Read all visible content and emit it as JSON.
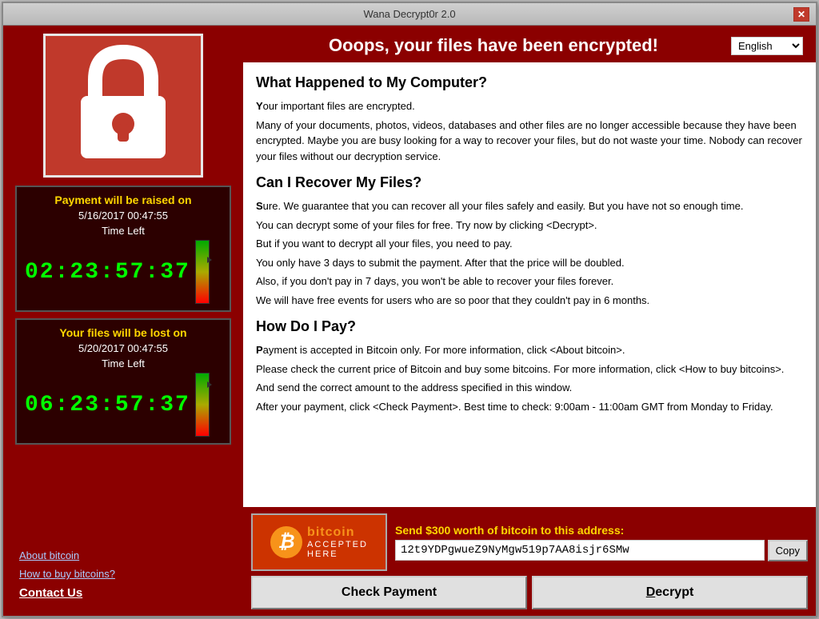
{
  "window": {
    "title": "Wana Decrypt0r 2.0",
    "close_btn": "✕"
  },
  "header": {
    "main_title": "Ooops, your files have been encrypted!",
    "language": "English"
  },
  "countdown1": {
    "label": "Payment will be raised on",
    "date": "5/16/2017 00:47:55",
    "time_left_label": "Time Left",
    "timer": "02:23:57:37"
  },
  "countdown2": {
    "label": "Your files will be lost on",
    "date": "5/20/2017 00:47:55",
    "time_left_label": "Time Left",
    "timer": "06:23:57:37"
  },
  "links": {
    "about_bitcoin": "About bitcoin",
    "how_to_buy": "How to buy bitcoins?",
    "contact_us": "Contact Us"
  },
  "content": {
    "section1_title": "What Happened to My Computer?",
    "section1_body": "Your important files are encrypted.\nMany of your documents, photos, videos, databases and other files are no longer accessible because they have been encrypted. Maybe you are busy looking for a way to recover your files, but do not waste your time. Nobody can recover your files without our decryption service.",
    "section2_title": "Can I Recover My Files?",
    "section2_body": "Sure. We guarantee that you can recover all your files safely and easily. But you have not so enough time.\nYou can decrypt some of your files for free. Try now by clicking <Decrypt>.\nBut if you want to decrypt all your files, you need to pay.\nYou only have 3 days to submit the payment. After that the price will be doubled.\nAlso, if you don't pay in 7 days, you won't be able to recover your files forever.\nWe will have free events for users who are so poor that they couldn't pay in 6 months.",
    "section3_title": "How Do I Pay?",
    "section3_body": "Payment is accepted in Bitcoin only. For more information, click <About bitcoin>.\nPlease check the current price of Bitcoin and buy some bitcoins. For more information, click <How to buy bitcoins>.\nAnd send the correct amount to the address specified in this window.\nAfter your payment, click <Check Payment>. Best time to check: 9:00am - 11:00am GMT from Monday to Friday."
  },
  "payment": {
    "send_label": "Send $300 worth of bitcoin to this address:",
    "address": "12t9YDPgwueZ9NyMgw519p7AA8isjr6SMw",
    "copy_label": "Copy",
    "bitcoin_top": "bitcoin",
    "bitcoin_accepted": "ACCEPTED",
    "bitcoin_here": "HERE",
    "check_payment": "Check Payment",
    "decrypt": "Decrypt"
  }
}
